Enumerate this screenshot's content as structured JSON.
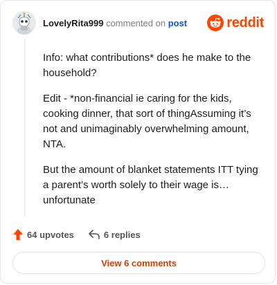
{
  "header": {
    "username": "LovelyRita999",
    "action_text": "commented on",
    "post_link": "post",
    "brand": "reddit"
  },
  "comment": {
    "paragraphs": [
      "Info: what contributions* does he make to the household?",
      "Edit - *non-financial ie caring for the kids, cooking dinner, that sort of thingAssuming it’s not and unimaginably overwhelming amount, NTA.",
      "But the amount of blanket statements ITT tying a parent’s worth solely to their wage is… unfortunate"
    ]
  },
  "actions": {
    "upvotes": "64 upvotes",
    "replies": "6 replies"
  },
  "footer": {
    "view_comments": "View 6 comments"
  },
  "colors": {
    "brand": "#ff4500",
    "link": "#0b58c6",
    "view_button_text": "#d23d00"
  },
  "icons": [
    "avatar-robot-icon",
    "reddit-alien-icon",
    "upvote-arrow-icon",
    "reply-arrow-icon"
  ]
}
